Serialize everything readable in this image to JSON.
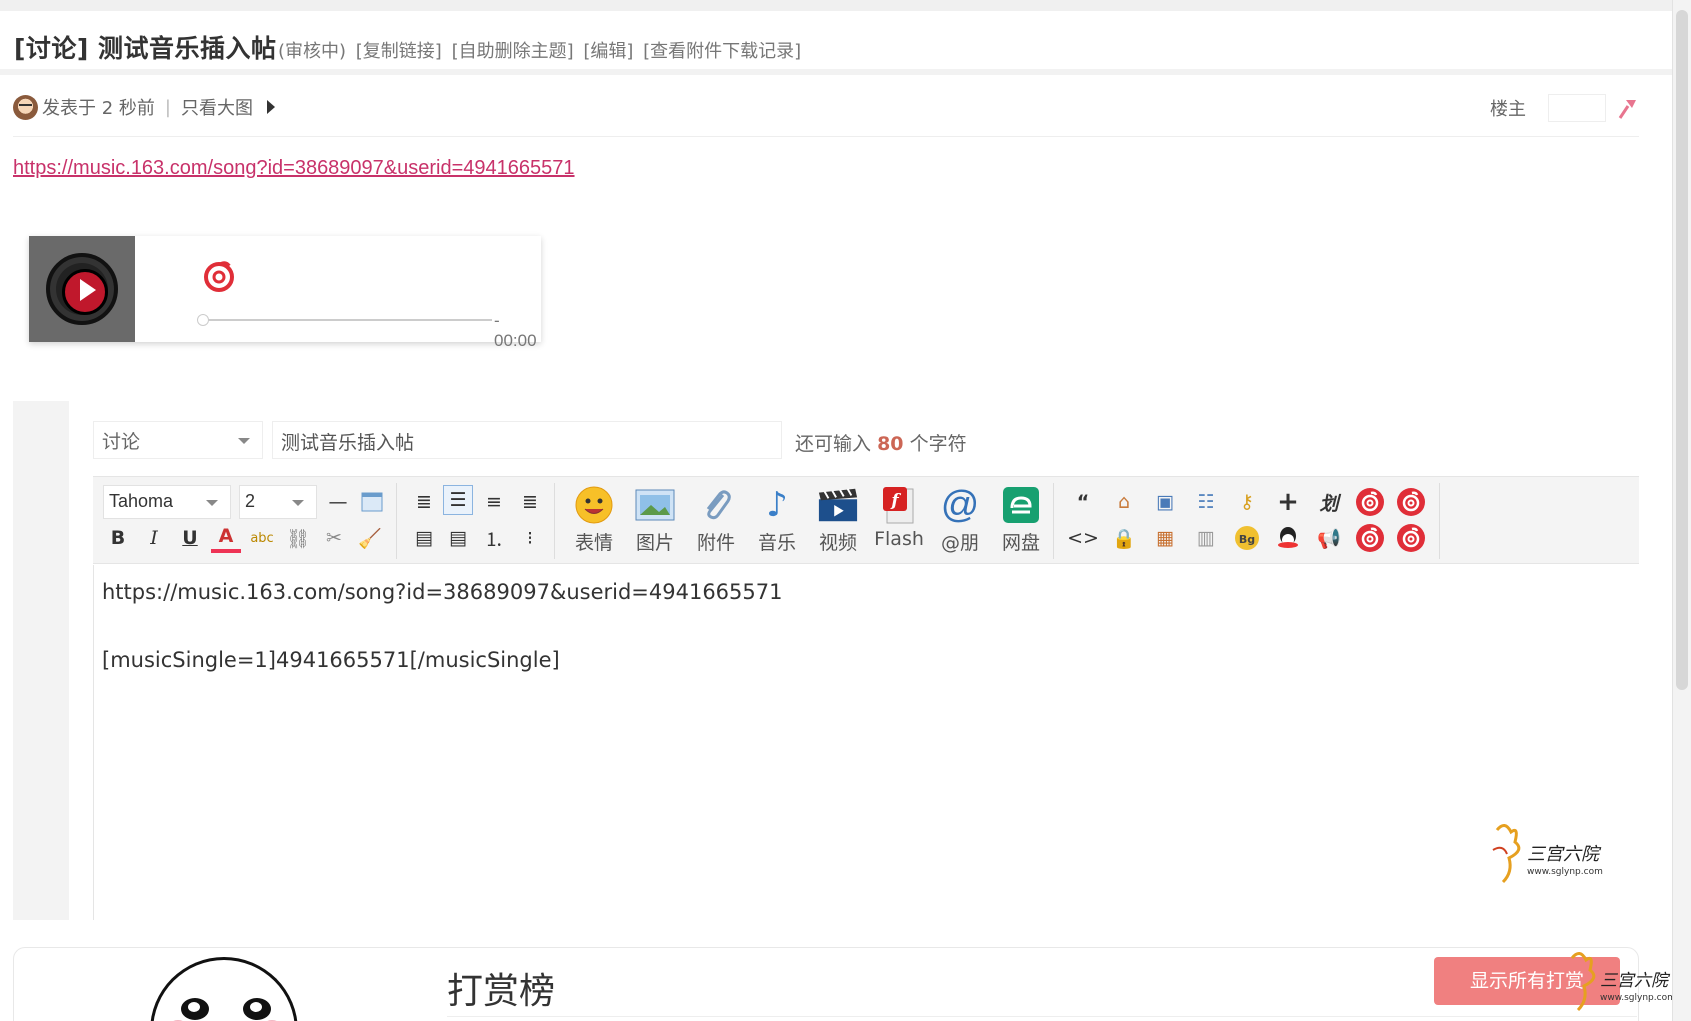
{
  "thread": {
    "title": "[讨论] 测试音乐插入帖",
    "actions": [
      "(审核中)",
      "[复制链接]",
      "[自助删除主题]",
      "[编辑]",
      "[查看附件下载记录]"
    ]
  },
  "post": {
    "posted": "发表于 2 秒前",
    "separator": "|",
    "only_big_images": "只看大图",
    "role": "楼主",
    "link": "https://music.163.com/song?id=38689097&userid=4941665571"
  },
  "player": {
    "time": "- 00:00",
    "progress": 0
  },
  "editor": {
    "type_select": "讨论",
    "subject": "测试音乐插入帖",
    "char_hint_prefix": "还可输入",
    "char_count": "80",
    "char_hint_suffix": "个字符",
    "font": "Tahoma",
    "size": "2",
    "big_buttons": [
      "表情",
      "图片",
      "附件",
      "音乐",
      "视频",
      "Flash",
      "@朋",
      "网盘"
    ],
    "content_lines": [
      "https://music.163.com/song?id=38689097&userid=4941665571",
      "",
      "[musicSingle=1]4941665571[/musicSingle]"
    ]
  },
  "reward": {
    "title": "打赏榜",
    "show_all": "显示所有打赏"
  },
  "watermark": {
    "name": "三宫六院",
    "url": "www.sglynp.com"
  },
  "colors": {
    "link": "#c8326a",
    "netease_red": "#e02e38",
    "reward_button": "#f08080",
    "char_count": "#cc6655"
  }
}
